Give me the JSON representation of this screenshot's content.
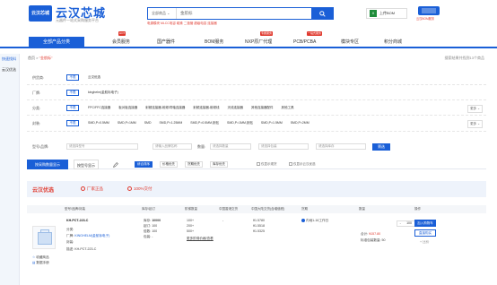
{
  "header": {
    "logo_mark": "云汉芯城",
    "logo_title": "云汉芯城",
    "logo_sub": "元器件一站式采购服务平台",
    "search_category": "全部商品",
    "search_query": "金航标",
    "hot_words": "电源模块  MLCC电容  磁珠  二极管  超级电容  连接器",
    "bom_label": "上传BOM",
    "svc_label": "云汉BOM服务"
  },
  "nav": {
    "all_label": "全部产品分类",
    "items": [
      "会员服务",
      "国产器件",
      "BOM服务",
      "NXP原厂代理",
      "PCB/PCBA",
      "模块专区",
      "积分商城"
    ],
    "tags": [
      "HOT",
      "专属服务",
      "一站式服务"
    ]
  },
  "rail": {
    "items": [
      "快速找料",
      "云汉优选"
    ]
  },
  "breadcrumb": {
    "home": "首页",
    "sep": ">",
    "current": "\"金航标\"",
    "right_text": "搜索结果共找到13个商品"
  },
  "filters": [
    {
      "label": "供货商:",
      "unlimited": "不限",
      "options": [
        "云汉优选"
      ]
    },
    {
      "label": "厂牌:",
      "unlimited": "不限",
      "options": [
        "kinghelm(金航标电子)"
      ]
    },
    {
      "label": "分类:",
      "unlimited": "不限",
      "options": [
        "FPC/FFC连接器",
        "板对板连接器",
        "射频连接器-射频/同轴连接器",
        "射频连接器-射频线",
        "天线连接器",
        "其他连接器配件",
        "其他工具"
      ],
      "more": "更多 ⌄"
    },
    {
      "label": "封装:",
      "unlimited": "不限",
      "options": [
        "SMD,P=0.5MM",
        "SMD,P=1MM",
        "SMD",
        "SMD,P=1.25MM",
        "SMD,P=0.5MM,卧贴",
        "SMD,P=1MM,卧贴",
        "SMD,P=1.5MM",
        "SMD,P=2MM"
      ],
      "more": "更多 ⌄"
    }
  ],
  "params": {
    "label": "型号/品牌:",
    "model_placeholder": "请选择型号",
    "brand_placeholder": "请输入品牌名称",
    "qty_label": "数量:",
    "qty_placeholder": "请选择数量",
    "pack_placeholder": "请选择包装",
    "stock_placeholder": "请选择库存",
    "btn": "筛选"
  },
  "view": {
    "tab_list": "按采购数量显示",
    "tab_detail": "按型号显示",
    "sorts": [
      "综合排序",
      "价格优先",
      "货期优先",
      "库存优先"
    ],
    "checks": [
      "仅显示现货",
      "仅显示云汉优选"
    ]
  },
  "promo": {
    "title": "云汉优选",
    "badge1": "厂家正品",
    "badge2": "100%交付"
  },
  "table_headers": [
    "型号/品牌/封装",
    "库存/起订",
    "阶梯数量",
    "中国香港交货",
    "中国大陆交货(含增值税)",
    "货期",
    "数量",
    "操作"
  ],
  "product": {
    "model": "KH-PCT-223-C",
    "category_label": "分类:",
    "category": "",
    "brand_label": "厂牌:",
    "brand": "KINGHELM(金航标电子)",
    "pkg_label": "封装:",
    "desc_label": "描述:",
    "desc": "KH-PCT-223-C",
    "fav": "收藏商品",
    "datasheet": "数据手册",
    "stock_label": "库存:",
    "stock": "10000",
    "moq_label": "起订:",
    "moq": "100",
    "mult_label": "倍数:",
    "mult": "100",
    "unit_label": "包装:",
    "unit": "-",
    "tiers": [
      "100+",
      "200+",
      "500+"
    ],
    "tiers_link": "更多阶梯价格/查看",
    "hk_price": "-",
    "cn_prices": [
      "¥1.5780",
      "¥1.5518",
      "¥1.5325"
    ],
    "lead_option": "内地1-16工作日",
    "qty_minus": "-",
    "qty_value": "100",
    "qty_plus": "+",
    "sum_label": "合计:",
    "sum": "¥157.80",
    "pkg_info": "标准包装数量: 50",
    "btn_cart": "加入购物车",
    "btn_buy": "直接购买",
    "btn_compare": "+ 比价"
  }
}
